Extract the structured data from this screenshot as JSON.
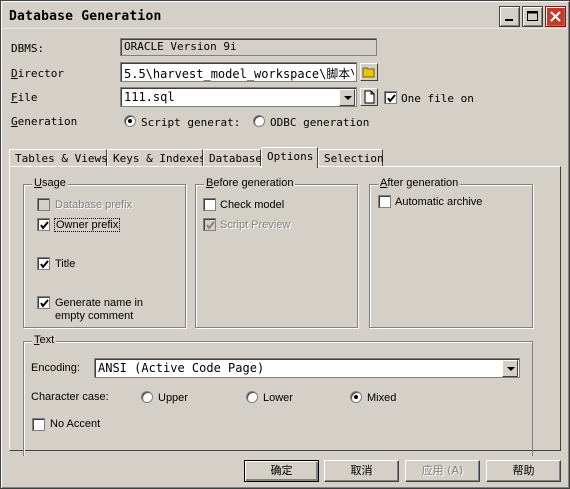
{
  "window": {
    "title": "Database Generation",
    "controls": {
      "minimize": "minimize-icon",
      "maximize": "maximize-icon",
      "close": "close-icon"
    }
  },
  "form": {
    "dbms": {
      "label": "DBMS:",
      "value": "ORACLE Version 9i"
    },
    "director": {
      "label": "Director",
      "value": "5.5\\harvest_model_workspace\\脚本\\"
    },
    "file": {
      "label": "File",
      "value": "111.sql",
      "one_file_label": "One file on",
      "one_file_checked": true
    },
    "generation": {
      "label": "Generation",
      "option_script": "Script generat:",
      "option_odbc": "ODBC generation",
      "selected": "script"
    }
  },
  "tabs": [
    {
      "label": "Tables & Views"
    },
    {
      "label": "Keys & Indexes"
    },
    {
      "label": "Database"
    },
    {
      "label": "Options",
      "active": true
    },
    {
      "label": "Selection"
    }
  ],
  "usage": {
    "title": "Usage",
    "database_prefix": {
      "label": "Database prefix",
      "checked": false,
      "enabled": false
    },
    "owner_prefix": {
      "label": "Owner prefix",
      "checked": true,
      "enabled": true
    },
    "title_opt": {
      "label": "Title",
      "checked": true,
      "enabled": true
    },
    "generate_name_line1": "Generate name in",
    "generate_name_line2": "empty comment",
    "generate_name_checked": true
  },
  "before_generation": {
    "title": "Before generation",
    "check_model": {
      "label": "Check model",
      "checked": false,
      "enabled": true
    },
    "script_preview": {
      "label": "Script Preview",
      "checked": true,
      "enabled": false
    }
  },
  "after_generation": {
    "title": "After generation",
    "automatic_archive": {
      "label": "Automatic archive",
      "checked": false,
      "enabled": true
    }
  },
  "text": {
    "title": "Text",
    "encoding_label": "Encoding:",
    "encoding_value": "ANSI (Active Code Page)",
    "case_label": "Character case:",
    "case_upper": "Upper",
    "case_lower": "Lower",
    "case_mixed": "Mixed",
    "case_selected": "Mixed",
    "no_accent": {
      "label": "No Accent",
      "checked": false
    }
  },
  "buttons": {
    "ok": "确定",
    "cancel": "取消",
    "apply": "应用 (A)",
    "help": "帮助"
  },
  "colors": {
    "close_button": "#c43b2a",
    "folder_icon": "#e8c800",
    "face": "#d4d0c8"
  }
}
